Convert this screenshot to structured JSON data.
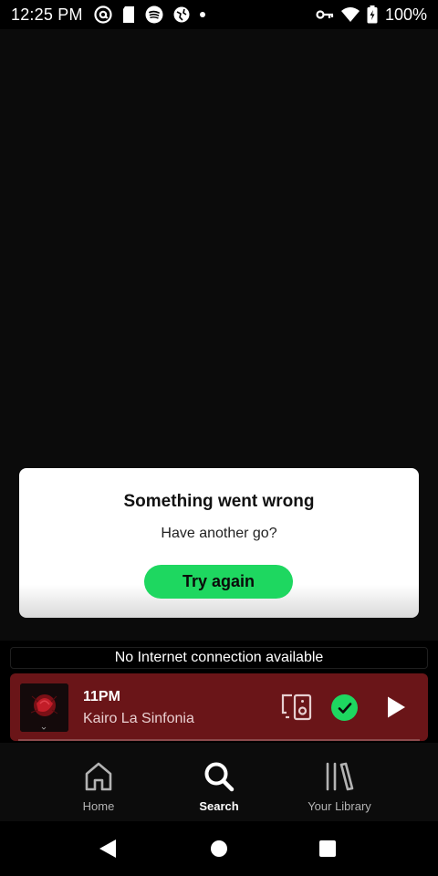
{
  "status_bar": {
    "time": "12:25 PM",
    "battery": "100%",
    "icons": [
      "at-sign-icon",
      "sim-card-icon",
      "spotify-icon",
      "vpn-globe-icon",
      "notification-dot-icon",
      "vpn-key-icon",
      "wifi-icon",
      "battery-charging-icon"
    ]
  },
  "error_dialog": {
    "title": "Something went wrong",
    "subtitle": "Have another go?",
    "button": "Try again"
  },
  "offline_banner": "No Internet connection available",
  "mini_player": {
    "title": "11PM",
    "artist": "Kairo La Sinfonia",
    "liked": true,
    "background": "#6a1518",
    "controls": [
      "devices-icon",
      "check-circle-icon",
      "play-icon"
    ]
  },
  "bottom_nav": {
    "items": [
      {
        "label": "Home",
        "icon": "home-icon",
        "active": false
      },
      {
        "label": "Search",
        "icon": "search-icon",
        "active": true
      },
      {
        "label": "Your Library",
        "icon": "library-icon",
        "active": false
      }
    ]
  },
  "system_nav": [
    "back-icon",
    "home-circle-icon",
    "recents-icon"
  ],
  "colors": {
    "accent": "#1ed760",
    "background": "#000000"
  }
}
